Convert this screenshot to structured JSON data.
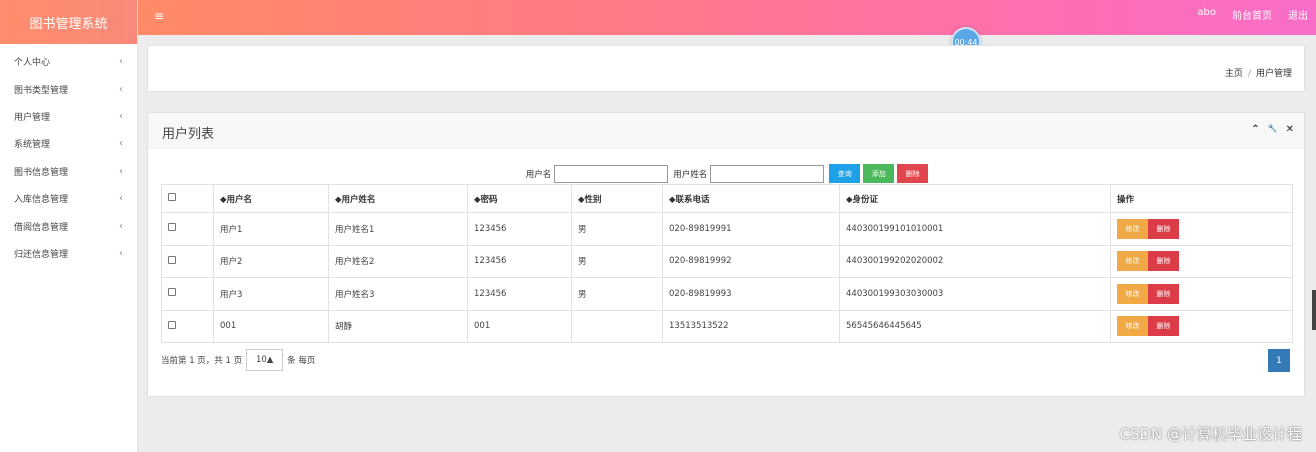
{
  "app": {
    "title": "图书管理系统"
  },
  "sidebar": {
    "items": [
      {
        "label": "个人中心"
      },
      {
        "label": "图书类型管理"
      },
      {
        "label": "用户管理"
      },
      {
        "label": "系统管理"
      },
      {
        "label": "图书信息管理"
      },
      {
        "label": "入库信息管理"
      },
      {
        "label": "借阅信息管理"
      },
      {
        "label": "归还信息管理"
      }
    ],
    "chevron": "‹"
  },
  "topbar": {
    "menu_icon": "≡",
    "user": "abo",
    "frontpage": "前台首页",
    "logout": "退出",
    "gradient_start": "#ff8a66",
    "gradient_end": "#f86dc8"
  },
  "timer": "00:44",
  "breadcrumb": {
    "home": "主页",
    "sep": "/",
    "current": "用户管理"
  },
  "panel": {
    "title": "用户列表",
    "tools": {
      "collapse": "⌃",
      "settings": "🔧",
      "close": "✕"
    }
  },
  "search": {
    "username_label": "用户名",
    "username_value": "",
    "realname_label": "用户姓名",
    "realname_value": "",
    "query_btn": "查询",
    "add_btn": "添加",
    "delete_btn": "删除"
  },
  "table": {
    "headers": [
      "◆用户名",
      "◆用户姓名",
      "◆密码",
      "◆性别",
      "◆联系电话",
      "◆身份证",
      "操作"
    ],
    "rows": [
      {
        "username": "用户1",
        "realname": "用户姓名1",
        "password": "123456",
        "gender": "男",
        "phone": "020-89819991",
        "idcard": "440300199101010001"
      },
      {
        "username": "用户2",
        "realname": "用户姓名2",
        "password": "123456",
        "gender": "男",
        "phone": "020-89819992",
        "idcard": "440300199202020002"
      },
      {
        "username": "用户3",
        "realname": "用户姓名3",
        "password": "123456",
        "gender": "男",
        "phone": "020-89819993",
        "idcard": "440300199303030003"
      },
      {
        "username": "001",
        "realname": "胡静",
        "password": "001",
        "gender": "",
        "phone": "13513513522",
        "idcard": "56545646445645"
      }
    ],
    "edit_btn": "修改",
    "delete_btn": "删除"
  },
  "pager": {
    "info_prefix": "当前第 1 页，共 1 页",
    "page_size": "10▲",
    "info_suffix": "条 每页",
    "current_page": "1"
  },
  "watermark": "CSDN @计算机毕业设计程"
}
